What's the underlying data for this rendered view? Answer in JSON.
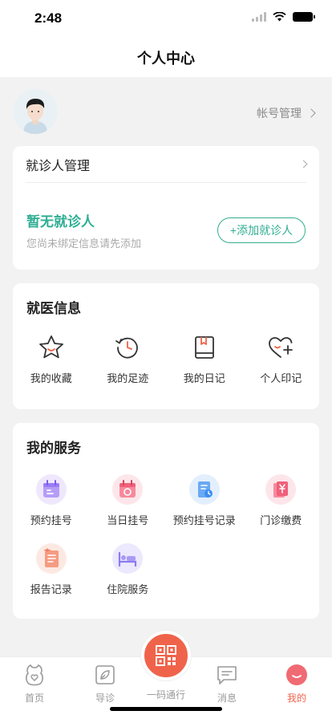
{
  "status": {
    "time": "2:48"
  },
  "nav": {
    "title": "个人中心"
  },
  "profile": {
    "account_label": "帐号管理"
  },
  "patient": {
    "header": "就诊人管理",
    "empty_title": "暂无就诊人",
    "empty_hint": "您尚未绑定信息请先添加",
    "add_button": "+添加就诊人"
  },
  "medical": {
    "title": "就医信息",
    "items": [
      {
        "label": "我的收藏",
        "icon": "star-icon"
      },
      {
        "label": "我的足迹",
        "icon": "history-icon"
      },
      {
        "label": "我的日记",
        "icon": "diary-icon"
      },
      {
        "label": "个人印记",
        "icon": "heart-plus-icon"
      }
    ]
  },
  "services": {
    "title": "我的服务",
    "items": [
      {
        "label": "预约挂号",
        "icon": "calendar-appointment-icon",
        "color": "#9b7cf5"
      },
      {
        "label": "当日挂号",
        "icon": "calendar-today-icon",
        "color": "#f0607a"
      },
      {
        "label": "预约挂号记录",
        "icon": "appointment-record-icon",
        "color": "#3d8ef0"
      },
      {
        "label": "门诊缴费",
        "icon": "payment-icon",
        "color": "#f0607a"
      },
      {
        "label": "报告记录",
        "icon": "report-icon",
        "color": "#f07a5c"
      },
      {
        "label": "住院服务",
        "icon": "hospital-bed-icon",
        "color": "#8a7cf0"
      }
    ]
  },
  "tabs": [
    {
      "label": "首页",
      "icon": "home-icon",
      "active": false
    },
    {
      "label": "导诊",
      "icon": "guide-icon",
      "active": false
    },
    {
      "label": "一码通行",
      "icon": "qr-code-icon",
      "active": false
    },
    {
      "label": "消息",
      "icon": "message-icon",
      "active": false
    },
    {
      "label": "我的",
      "icon": "profile-icon",
      "active": true
    }
  ],
  "colors": {
    "accent": "#2fae93",
    "qr": "#f0634b",
    "active_tab": "#f0634b"
  }
}
